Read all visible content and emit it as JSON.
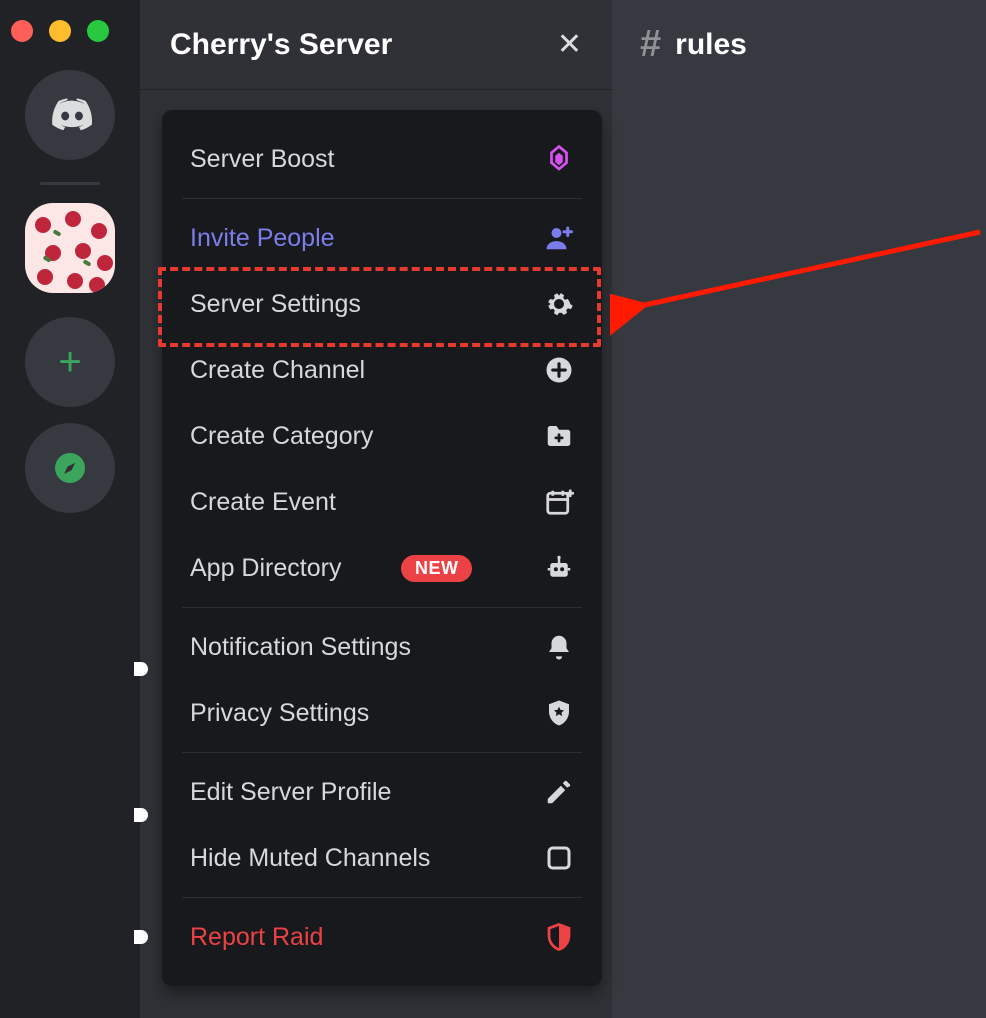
{
  "server": {
    "name": "Cherry's Server"
  },
  "channel": {
    "name": "rules"
  },
  "menu": {
    "server_boost": "Server Boost",
    "invite_people": "Invite People",
    "server_settings": "Server Settings",
    "create_channel": "Create Channel",
    "create_category": "Create Category",
    "create_event": "Create Event",
    "app_directory": "App Directory",
    "new_badge": "NEW",
    "notification_settings": "Notification Settings",
    "privacy_settings": "Privacy Settings",
    "edit_server_profile": "Edit Server Profile",
    "hide_muted_channels": "Hide Muted Channels",
    "report_raid": "Report Raid"
  },
  "colors": {
    "highlight": "#e63a2e",
    "invite": "#7b7dea",
    "danger": "#ed4245",
    "boost": "#d552f0"
  }
}
